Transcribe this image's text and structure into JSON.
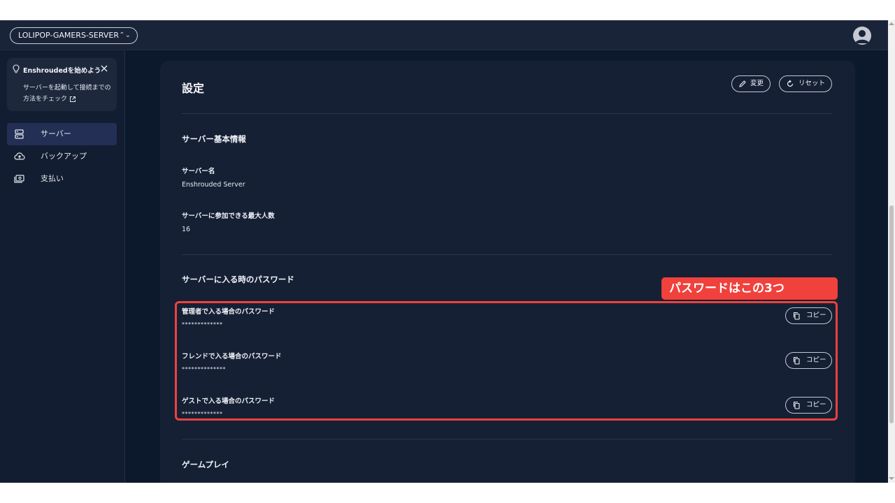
{
  "header": {
    "server_name": "LOLIPOP-GAMERS-SERVER"
  },
  "sidebar": {
    "hint": {
      "title": "Enshroudedを始めよう",
      "body": "サーバーを起動して接続までの方法をチェック"
    },
    "items": [
      {
        "label": "サーバー",
        "icon": "server-icon",
        "active": true
      },
      {
        "label": "バックアップ",
        "icon": "cloud-upload-icon",
        "active": false
      },
      {
        "label": "支払い",
        "icon": "payment-icon",
        "active": false
      }
    ]
  },
  "main": {
    "title": "設定",
    "edit_label": "変更",
    "reset_label": "リセット",
    "basic_info": {
      "title": "サーバー基本情報",
      "server_name_label": "サーバー名",
      "server_name_value": "Enshrouded Server",
      "max_players_label": "サーバーに参加できる最大人数",
      "max_players_value": "16"
    },
    "passwords": {
      "title": "サーバーに入る時のパスワード",
      "copy_label": "コピー",
      "items": [
        {
          "label": "管理者で入る場合のパスワード",
          "value": "*************"
        },
        {
          "label": "フレンドで入る場合のパスワード",
          "value": "**************"
        },
        {
          "label": "ゲストで入る場合のパスワード",
          "value": "*************"
        }
      ]
    },
    "gameplay": {
      "title": "ゲームプレイ"
    }
  },
  "annotation": {
    "callout": "パスワードはこの3つ",
    "color": "#f0413c"
  }
}
